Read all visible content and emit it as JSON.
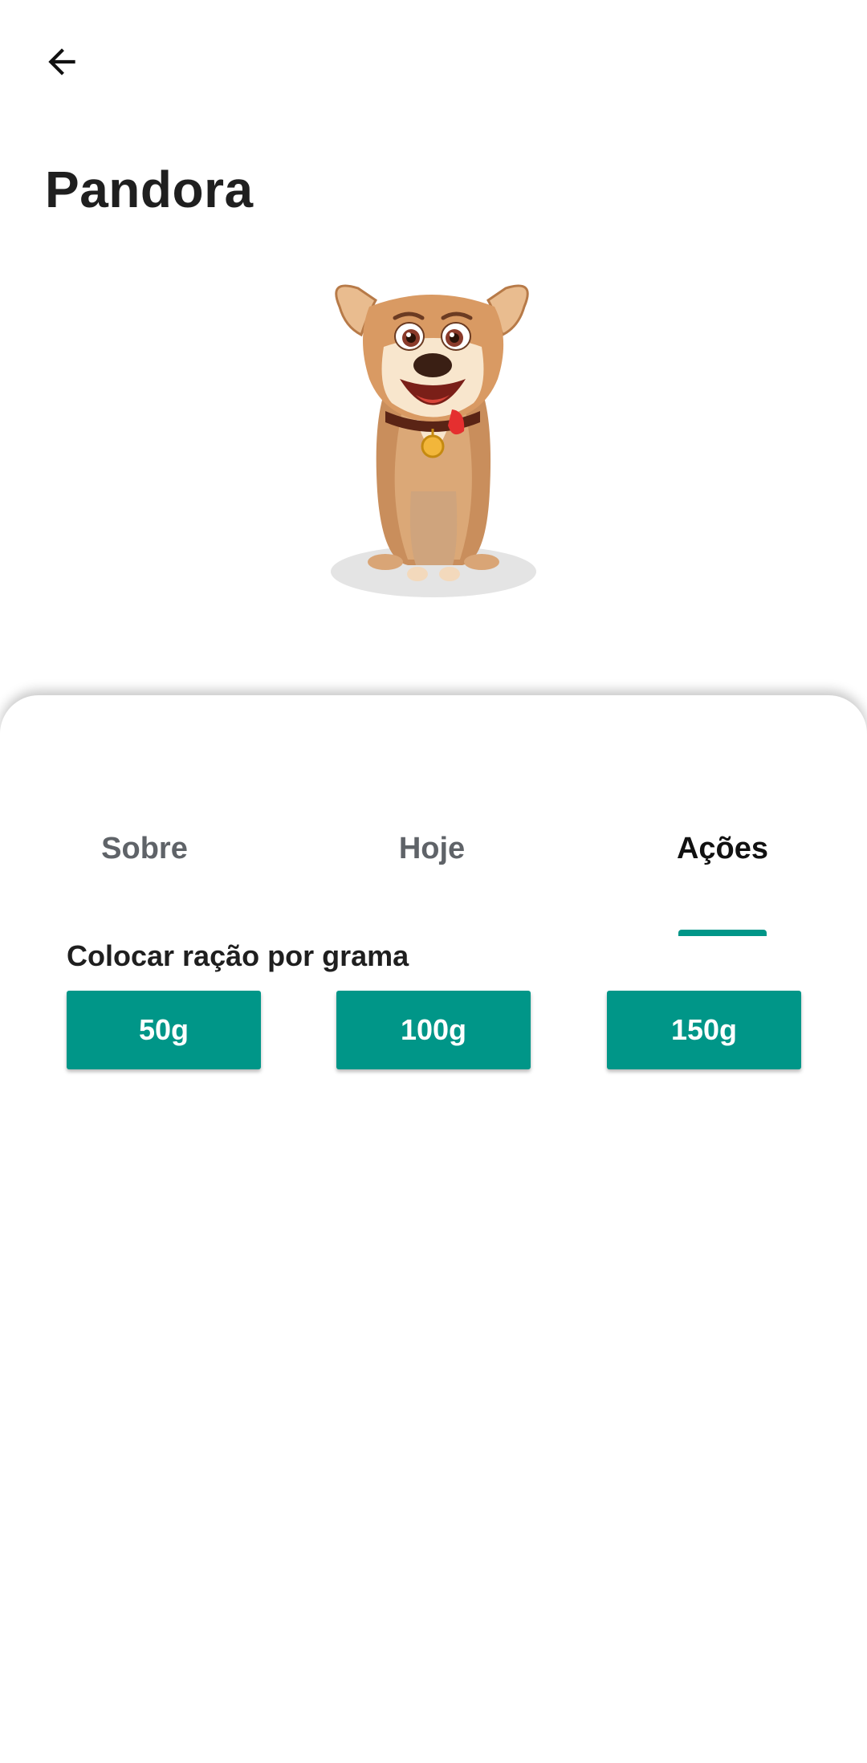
{
  "header": {
    "back_icon": "arrow-left-icon",
    "title": "Pandora"
  },
  "pet": {
    "illustration": "cartoon-dog-illustration"
  },
  "tabs": [
    {
      "label": "Sobre",
      "selected": false
    },
    {
      "label": "Hoje",
      "selected": false
    },
    {
      "label": "Ações",
      "selected": true
    }
  ],
  "actions": {
    "section_title": "Colocar ração por grama",
    "buttons": [
      {
        "label": "50g"
      },
      {
        "label": "100g"
      },
      {
        "label": "150g"
      }
    ]
  },
  "colors": {
    "accent": "#009688",
    "title_text": "#1f1f1f",
    "inactive_tab": "#5f6368"
  }
}
